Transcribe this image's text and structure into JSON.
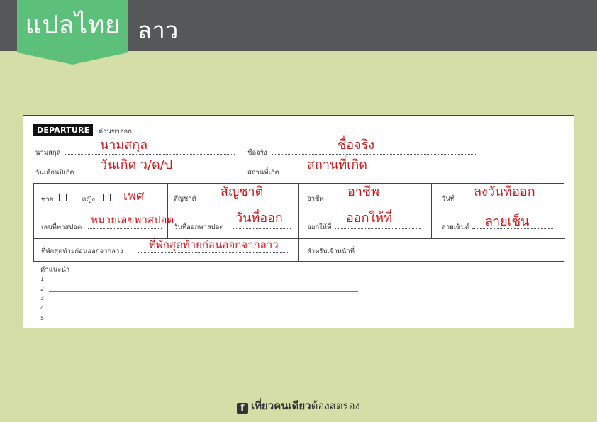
{
  "header": {
    "brand": "แปลไทย",
    "language": "ลาว"
  },
  "card": {
    "departure_tag": "DEPARTURE",
    "checkpoint_label": "ด่านขาออก",
    "surname_label": "นามสกุล",
    "surname_value": "นามสกุล",
    "firstname_label": "ชื่อจริง",
    "firstname_value": "ชื่อจริง",
    "dob_label": "วันเดือนปีเกิด",
    "dob_value": "วันเกิด ว/ด/ป",
    "pob_label": "สถานที่เกิด",
    "pob_value": "สถานที่เกิด",
    "male_label": "ชาย",
    "female_label": "หญิง",
    "sex_value": "เพศ",
    "nationality_label": "สัญชาติ",
    "nationality_value": "สัญชาติ",
    "occupation_label": "อาชีพ",
    "occupation_value": "อาชีพ",
    "date_label": "วันที่",
    "date_value": "ลงวันที่ออก",
    "passport_no_label": "เลขที่พาสปอต",
    "passport_no_value": "หมายเลขพาสปอต",
    "passport_issue_label": "วันที่ออกพาสปอต",
    "passport_issue_value": "วันที่ออก",
    "issued_by_label": "ออกให้ที่",
    "issued_by_value": "ออกให้ที่",
    "signature_label": "ลายเซ็นต์",
    "signature_value": "ลายเซ็น",
    "last_stay_label": "ที่พักสุดท้ายก่อนออกจากลาว",
    "last_stay_value": "ที่พักสุดท้ายก่อนออกจากลาว",
    "officer_label": "สำหรับเจ้าหน้าที่",
    "advice_label": "คำแนะนำ",
    "advice_numbers": [
      "1.",
      "2.",
      "3.",
      "4.",
      "5."
    ]
  },
  "footer": {
    "fb_icon": "f",
    "bold_text": "เที่ยวคนเดียว",
    "text": "ต้องสตรอง"
  },
  "colors": {
    "topbar": "#555759",
    "badge": "#5cbf7a",
    "background": "#d6dea8",
    "handwriting": "#cc1a1a"
  }
}
